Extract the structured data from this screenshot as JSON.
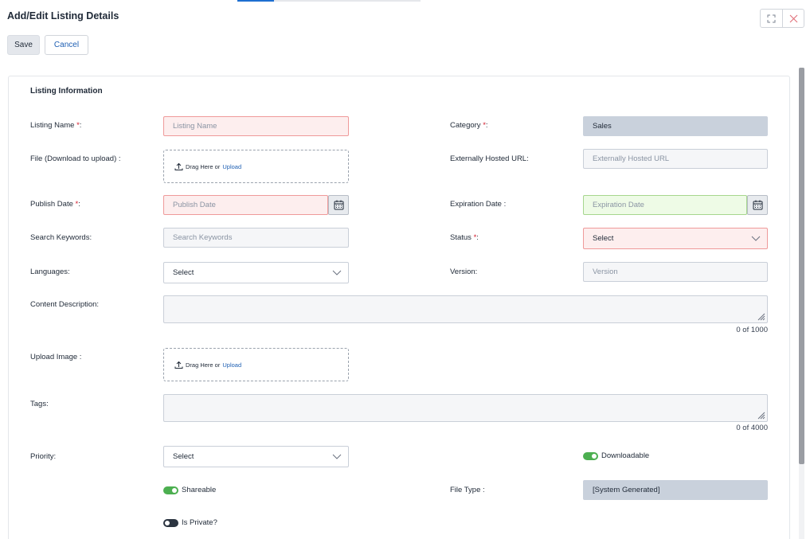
{
  "header": {
    "title": "Add/Edit Listing Details",
    "progress_fraction": 0.2
  },
  "toolbar": {
    "save_label": "Save",
    "cancel_label": "Cancel"
  },
  "section": {
    "title": "Listing Information"
  },
  "fields": {
    "listing_name": {
      "label": "Listing Name ",
      "req": "*",
      "suffix": ":",
      "placeholder": "Listing Name"
    },
    "category": {
      "label": "Category ",
      "req": "*",
      "suffix": ":",
      "value": "Sales"
    },
    "file": {
      "label": "File (Download to upload) :",
      "drag_text": "Drag Here or",
      "upload_text": "Upload"
    },
    "external_url": {
      "label": "Externally Hosted URL:",
      "placeholder": "Externally Hosted URL"
    },
    "publish_date": {
      "label": "Publish Date ",
      "req": "*",
      "suffix": ":",
      "placeholder": "Publish Date"
    },
    "expiration_date": {
      "label": "Expiration Date :",
      "placeholder": "Expiration Date"
    },
    "search_keywords": {
      "label": "Search Keywords:",
      "placeholder": "Search Keywords"
    },
    "status": {
      "label": "Status ",
      "req": "*",
      "suffix": ":",
      "value": "Select"
    },
    "languages": {
      "label": "Languages:",
      "value": "Select"
    },
    "version": {
      "label": "Version:",
      "placeholder": "Version"
    },
    "content_description": {
      "label": "Content Description:",
      "counter": "0 of 1000"
    },
    "upload_image": {
      "label": "Upload Image :",
      "drag_text": "Drag Here or",
      "upload_text": "Upload"
    },
    "tags": {
      "label": "Tags:",
      "counter": "0 of 4000"
    },
    "priority": {
      "label": "Priority:",
      "value": "Select"
    },
    "file_type": {
      "label": "File Type :",
      "value": "[System Generated]"
    }
  },
  "toggles": {
    "downloadable": {
      "label": "Downloadable",
      "on": true
    },
    "shareable": {
      "label": "Shareable",
      "on": true
    },
    "is_private": {
      "label": "Is Private?",
      "on": false
    }
  },
  "colors": {
    "accent": "#1e6fd0",
    "error_bg": "#fdeeee",
    "success_bg": "#eefbe6",
    "toggle_on": "#4caf50",
    "toggle_off": "#2b3440"
  },
  "icons": {
    "calendar": "calendar-icon",
    "chevron": "chevron-down-icon",
    "upload": "upload-icon",
    "expand": "expand-icon",
    "close": "close-icon"
  }
}
